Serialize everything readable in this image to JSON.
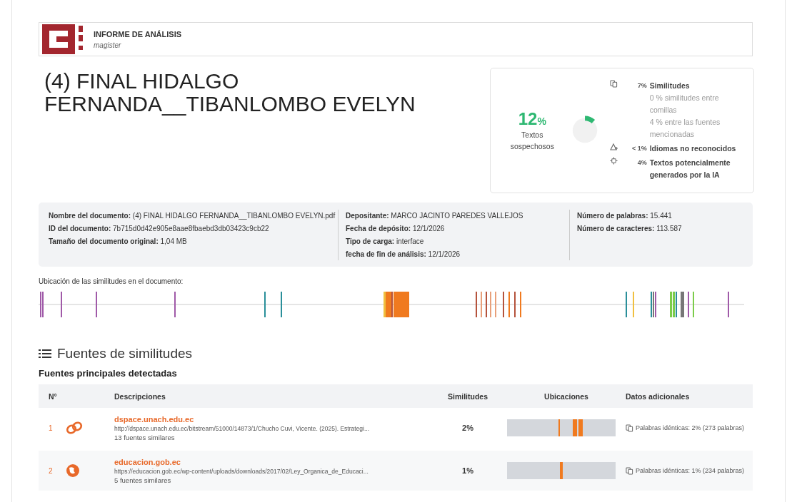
{
  "header": {
    "title": "INFORME DE ANÁLISIS",
    "subtitle": "magister"
  },
  "document_title": "(4) FINAL HIDALGO FERNANDA__TIBANLOMBO EVELYN",
  "score": {
    "value": "12",
    "unit": "%",
    "label": "Textos sospechosos",
    "items": [
      {
        "kind": "similarity",
        "value": "7%",
        "label": "Similitudes",
        "subitems": [
          {
            "value": "0 %",
            "label": "similitudes entre comillas"
          },
          {
            "value": "4 %",
            "label": "entre las fuentes mencionadas"
          }
        ]
      },
      {
        "kind": "language",
        "value": "< 1%",
        "label": "Idiomas no reconocidos"
      },
      {
        "kind": "ai",
        "value": "4%",
        "label": "Textos potencialmente generados por la IA"
      }
    ]
  },
  "metadata": [
    [
      {
        "label": "Nombre del documento:",
        "value": "(4) FINAL HIDALGO FERNANDA__TIBANLOMBO EVELYN.pdf"
      },
      {
        "label": "ID del documento:",
        "value": "7b715d0d42e905e8aae8fbaebd3db03423c9cb22"
      },
      {
        "label": "Tamaño del documento original:",
        "value": "1,04 MB"
      }
    ],
    [
      {
        "label": "Depositante:",
        "value": "MARCO JACINTO PAREDES VALLEJOS"
      },
      {
        "label": "Fecha de depósito:",
        "value": "12/1/2026"
      },
      {
        "label": "Tipo de carga:",
        "value": "interface"
      },
      {
        "label": "fecha de fin de análisis:",
        "value": "12/1/2026"
      }
    ],
    [
      {
        "label": "Número de palabras:",
        "value": "15.441"
      },
      {
        "label": "Número de caracteres:",
        "value": "113.587"
      }
    ]
  ],
  "locations_label": "Ubicación de las similitudes en el documento:",
  "section_title": "Fuentes de similitudes",
  "sources_title": "Fuentes principales detectadas",
  "table": {
    "columns": [
      "N°",
      "Descripciones",
      "Similitudes",
      "Ubicaciones",
      "Datos adicionales"
    ],
    "rows": [
      {
        "number": "1",
        "kind": "link",
        "domain": "dspace.unach.edu.ec",
        "url": "http://dspace.unach.edu.ec/bitstream/51000/14873/1/Chucho Cuvi, Vicente. (2025). Estrategi...",
        "similar": "13 fuentes similares",
        "similarity": "2%",
        "extra": "Palabras idénticas: 2% (273 palabras)"
      },
      {
        "number": "2",
        "kind": "globe",
        "domain": "educacion.gob.ec",
        "url": "https://educacion.gob.ec/wp-content/uploads/downloads/2017/02/Ley_Organica_de_Educaci...",
        "similar": "5 fuentes similares",
        "similarity": "1%",
        "extra": "Palabras idénticas: 1% (234 palabras)"
      }
    ]
  }
}
